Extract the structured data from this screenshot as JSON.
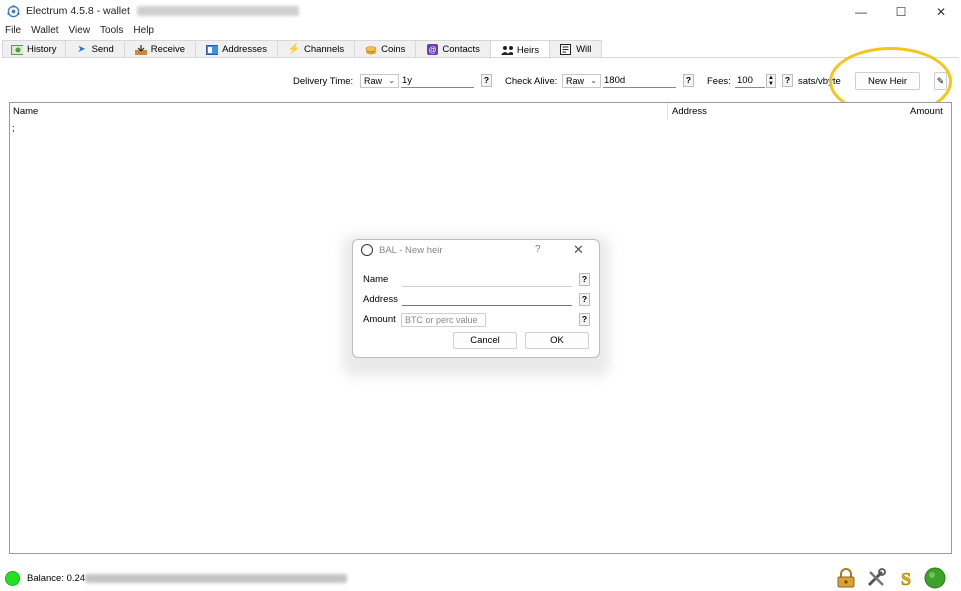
{
  "window": {
    "app_name": "Electrum 4.5.8",
    "title_sep": "-",
    "wallet_label": "wallet",
    "controls": {
      "minimize": "—",
      "maximize": "☐",
      "close": "✕"
    }
  },
  "menu": [
    "File",
    "Wallet",
    "View",
    "Tools",
    "Help"
  ],
  "tabs": [
    {
      "label": "History",
      "icon": "history-icon"
    },
    {
      "label": "Send",
      "icon": "send-icon"
    },
    {
      "label": "Receive",
      "icon": "receive-icon"
    },
    {
      "label": "Addresses",
      "icon": "addresses-icon"
    },
    {
      "label": "Channels",
      "icon": "lightning-icon"
    },
    {
      "label": "Coins",
      "icon": "coins-icon"
    },
    {
      "label": "Contacts",
      "icon": "contacts-icon"
    },
    {
      "label": "Heirs",
      "icon": "heirs-icon",
      "active": true
    },
    {
      "label": "Will",
      "icon": "will-icon"
    }
  ],
  "heirs_toolbar": {
    "delivery_time_label": "Delivery Time:",
    "delivery_mode": "Raw",
    "delivery_value": "1y",
    "check_alive_label": "Check Alive:",
    "check_alive_mode": "Raw",
    "check_alive_value": "180d",
    "fees_label": "Fees:",
    "fees_value": "100",
    "fees_unit": "sats/vbyte",
    "new_heir_button": "New Heir",
    "help": "?"
  },
  "table": {
    "columns": [
      "Name",
      "Address",
      "Amount"
    ],
    "row_marker": ";"
  },
  "dialog": {
    "title": "BAL - New heir",
    "title_help": "?",
    "close": "✕",
    "fields": {
      "name_label": "Name",
      "address_label": "Address",
      "amount_label": "Amount",
      "amount_placeholder": "BTC or perc value"
    },
    "help": "?",
    "cancel_button": "Cancel",
    "ok_button": "OK"
  },
  "status": {
    "balance_label": "Balance: 0.24",
    "online_color": "#22e022"
  },
  "colors": {
    "highlight": "#f5c518"
  }
}
